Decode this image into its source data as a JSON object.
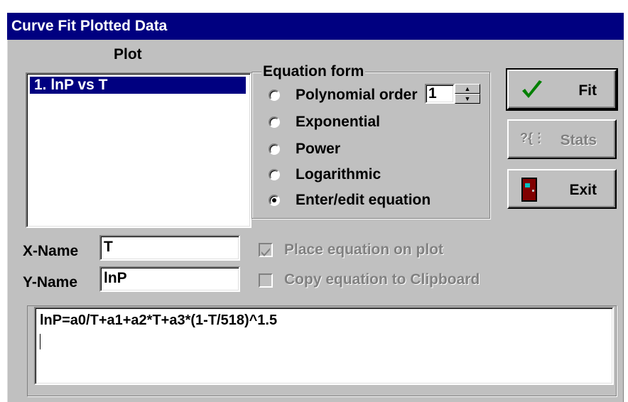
{
  "window": {
    "title": "Curve Fit Plotted Data"
  },
  "plot": {
    "label": "Plot",
    "items": [
      {
        "label": "1.  lnP vs T",
        "selected": true
      }
    ]
  },
  "equation_form": {
    "legend": "Equation form",
    "options": [
      {
        "label": "Polynomial order",
        "selected": false
      },
      {
        "label": "Exponential",
        "selected": false
      },
      {
        "label": "Power",
        "selected": false
      },
      {
        "label": "Logarithmic",
        "selected": false
      },
      {
        "label": "Enter/edit equation",
        "selected": true
      }
    ],
    "polynomial_order": "1"
  },
  "buttons": {
    "fit": {
      "label": "Fit",
      "icon": "checkmark-icon",
      "enabled": true
    },
    "stats": {
      "label": "Stats",
      "icon": "stats-icon",
      "enabled": false
    },
    "exit": {
      "label": "Exit",
      "icon": "door-icon",
      "enabled": true
    }
  },
  "fields": {
    "x_name": {
      "label": "X-Name",
      "value": "T"
    },
    "y_name": {
      "label": "Y-Name",
      "value": "lnP"
    }
  },
  "options": {
    "place_on_plot": {
      "label": "Place equation on plot",
      "checked": true,
      "enabled": false
    },
    "copy_to_clipboard": {
      "label": "Copy equation to Clipboard",
      "checked": false,
      "enabled": false
    }
  },
  "equation": {
    "text": "lnP=a0/T+a1+a2*T+a3*(1-T/518)^1.5"
  },
  "colors": {
    "title_bar": "#000080",
    "face": "#c0c0c0",
    "selection": "#000080",
    "check_green": "#008000",
    "door_red": "#800000"
  }
}
